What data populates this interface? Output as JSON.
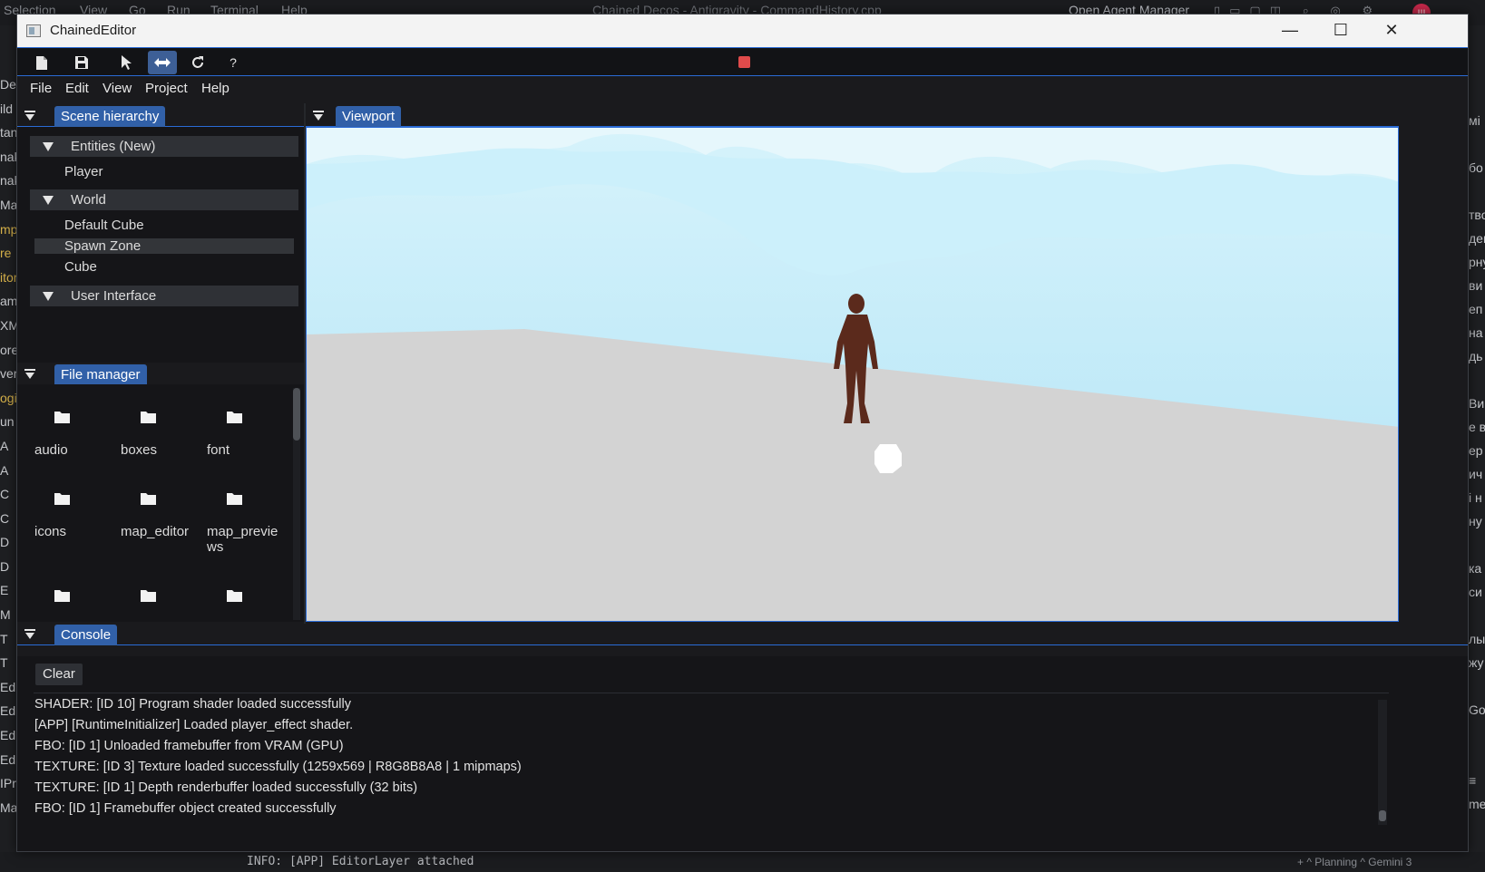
{
  "background_ide": {
    "menu": [
      "Selection",
      "View",
      "Go",
      "Run",
      "Terminal",
      "Help"
    ],
    "title": "Chained Decos - Antigravity - CommandHistory.cpp",
    "agent_manager": "Open Agent Manager",
    "avatar": "Ш",
    "left_fragments": [
      "Dec",
      "ild",
      "tan",
      "nak",
      "nak",
      "Mak",
      "mp",
      "re",
      "itor",
      "am",
      "XMA",
      "ore",
      "ver",
      "ogi",
      "un",
      "A",
      "A",
      "C",
      "C",
      "D",
      "D",
      "E",
      "M",
      "T",
      "T",
      "Ed",
      "Ed",
      "Ed",
      "Ed",
      "IPr",
      "Ma"
    ],
    "right_fragments": [
      "мі",
      "",
      "бо",
      "",
      "тво",
      "ден",
      "рну",
      "ви",
      "еп",
      "на",
      "дь",
      "",
      "Ви",
      "е в",
      "ер",
      "ич",
      "і н",
      "ну",
      "",
      "ка",
      "си",
      "",
      "лы",
      "жу",
      "",
      "Go",
      "",
      "",
      "≡",
      "me"
    ],
    "terminal_line": "INFO: [APP] EditorLayer attached",
    "bottom_tabs": "+   ^ Planning   ^ Gemini 3"
  },
  "window": {
    "title": "ChainedEditor",
    "controls": {
      "minimize": "—",
      "maximize": "☐",
      "close": "✕"
    }
  },
  "toolbar": {
    "buttons": [
      {
        "icon": "new-file-icon",
        "active": false
      },
      {
        "icon": "save-icon",
        "active": false
      },
      {
        "icon": "select-cursor-icon",
        "active": false
      },
      {
        "icon": "move-arrows-icon",
        "active": true
      },
      {
        "icon": "refresh-icon",
        "active": false
      },
      {
        "icon": "help-icon",
        "active": false,
        "label": "?"
      }
    ],
    "record_color": "#e04b4b"
  },
  "menubar": {
    "items": [
      "File",
      "Edit",
      "View",
      "Project",
      "Help"
    ]
  },
  "scene_hierarchy": {
    "tab_label": "Scene hierarchy",
    "groups": [
      {
        "label": "Entities (New)",
        "items": [
          "Player"
        ]
      },
      {
        "label": "World",
        "items": [
          "Default Cube",
          "Spawn Zone",
          "Cube"
        ]
      },
      {
        "label": "User Interface",
        "items": []
      }
    ],
    "selected_item": "Spawn Zone"
  },
  "file_manager": {
    "tab_label": "File manager",
    "folders": [
      "audio",
      "boxes",
      "font",
      "icons",
      "map_editor",
      "map_previews",
      "",
      "",
      ""
    ]
  },
  "viewport": {
    "tab_label": "Viewport",
    "colors": {
      "sky": "#c9edf8",
      "ground": "#d3d3d3",
      "player": "#5b2a1c",
      "cube": "#ffffff"
    }
  },
  "console": {
    "tab_label": "Console",
    "clear_label": "Clear",
    "lines": [
      "SHADER: [ID 10] Program shader loaded successfully",
      "[APP] [RuntimeInitializer] Loaded player_effect shader.",
      "FBO: [ID 1] Unloaded framebuffer from VRAM (GPU)",
      "TEXTURE: [ID 3] Texture loaded successfully (1259x569 | R8G8B8A8 | 1 mipmaps)",
      "TEXTURE: [ID 1] Depth renderbuffer loaded successfully (32 bits)",
      "FBO: [ID 1] Framebuffer object created successfully"
    ]
  },
  "colors": {
    "accent": "#2a6bd6",
    "tab": "#3160a8",
    "active_tool": "#3d5f96"
  }
}
